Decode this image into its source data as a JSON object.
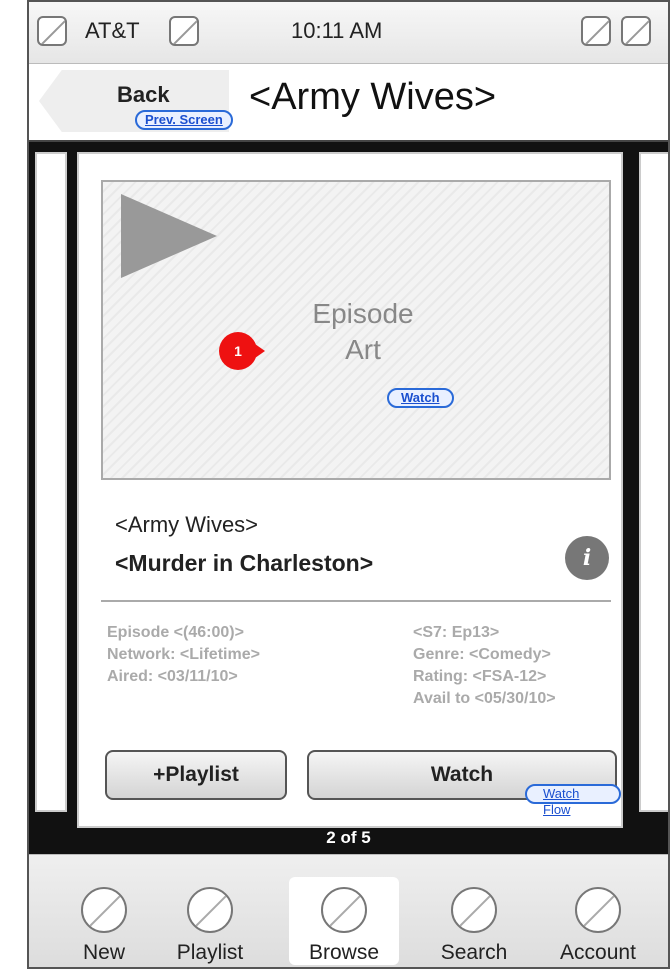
{
  "status_bar": {
    "carrier": "AT&T",
    "time": "10:11 AM"
  },
  "nav": {
    "back_label": "Back",
    "prev_link": "Prev. Screen",
    "title": "<Army Wives>"
  },
  "episode": {
    "art_label_line1": "Episode",
    "art_label_line2": "Art",
    "marker": "1",
    "art_watch_link": "Watch",
    "show": "<Army Wives>",
    "title": "<Murder in Charleston>",
    "info_icon": "i",
    "meta_left": [
      "Episode <(46:00)>",
      "Network: <Lifetime>",
      "Aired: <03/11/10>"
    ],
    "meta_right": [
      "<S7: Ep13>",
      "Genre: <Comedy>",
      "Rating: <FSA-12>",
      "Avail to <05/30/10>"
    ]
  },
  "actions": {
    "playlist": "+Playlist",
    "watch": "Watch",
    "watch_flow": "Watch Flow"
  },
  "pager": "2 of 5",
  "tabs": [
    {
      "label": "New",
      "icon": "new-icon"
    },
    {
      "label": "Playlist",
      "icon": "playlist-icon"
    },
    {
      "label": "Browse",
      "icon": "browse-icon",
      "active": true
    },
    {
      "label": "Search",
      "icon": "search-icon"
    },
    {
      "label": "Account",
      "icon": "account-icon"
    }
  ],
  "colors": {
    "link": "#2a6ad8",
    "marker": "#ee1111",
    "stage": "#111111"
  }
}
